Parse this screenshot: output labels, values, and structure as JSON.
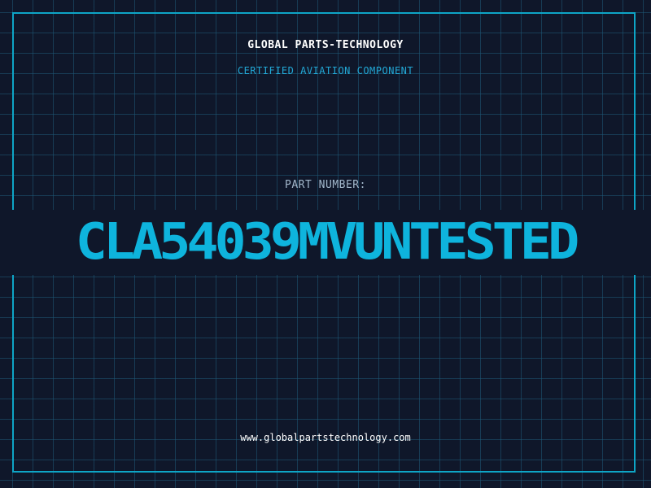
{
  "brand": {
    "name": "GLOBAL PARTS-TECHNOLOGY",
    "tagline": "CERTIFIED AVIATION COMPONENT"
  },
  "part": {
    "label": "PART NUMBER:",
    "number": "CLA54039MVUNTESTED"
  },
  "footer": {
    "website": "www.globalpartstechnology.com"
  },
  "colors": {
    "background": "#0f172a",
    "grid": "#1e5a78",
    "accent": "#0eb4dd",
    "label": "#a3b8cc",
    "text": "#ffffff"
  }
}
